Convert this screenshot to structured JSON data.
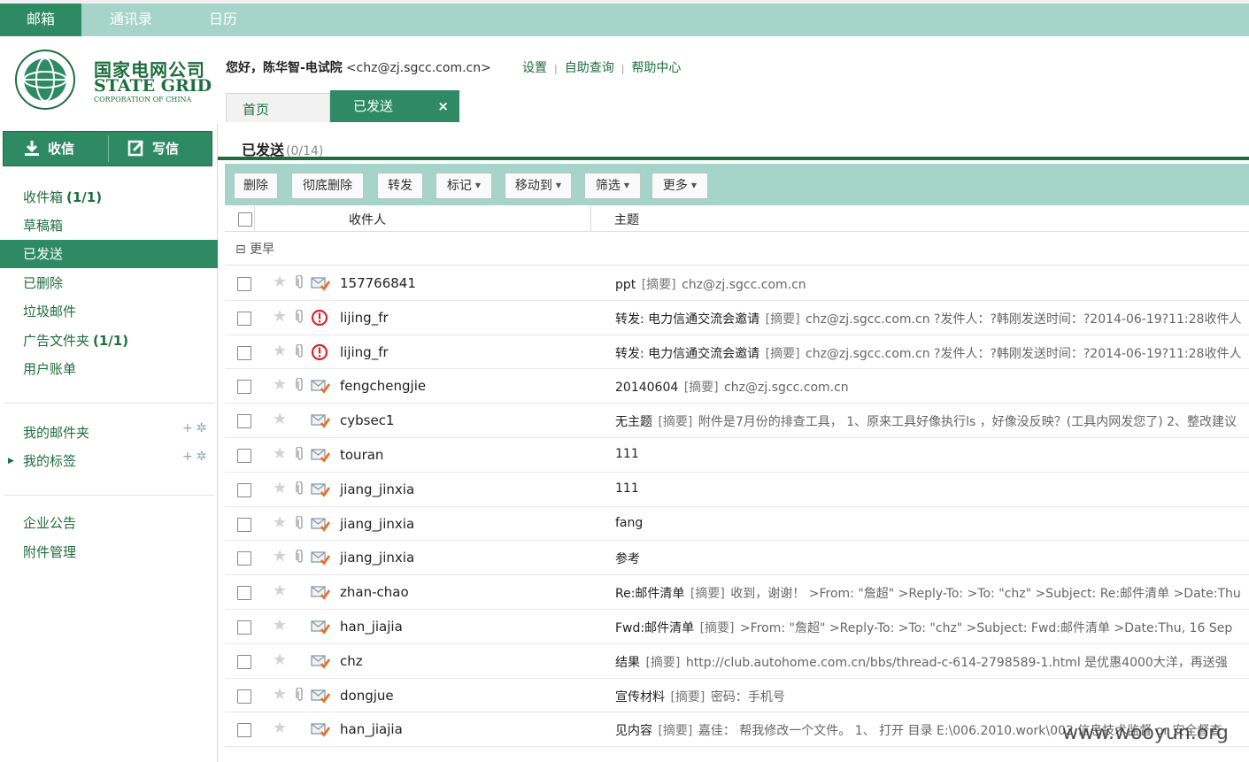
{
  "app_tabs": [
    "邮箱",
    "通讯录",
    "日历"
  ],
  "logo": {
    "cn": "国家电网公司",
    "en": "STATE GRID",
    "sub": "CORPORATION OF CHINA"
  },
  "header": {
    "greeting_prefix": "您好，",
    "user_name": "陈华智-电试院",
    "user_email": "<chz@zj.sgcc.com.cn>",
    "links": [
      "设置",
      "自助查询",
      "帮助中心"
    ]
  },
  "page_tabs": {
    "home": "首页",
    "sent": "已发送",
    "close": "×"
  },
  "sidebar": {
    "receive": "收信",
    "write": "写信",
    "folders": [
      {
        "label": "收件箱",
        "count": "(1/1)"
      },
      {
        "label": "草稿箱",
        "count": ""
      },
      {
        "label": "已发送",
        "count": ""
      },
      {
        "label": "已删除",
        "count": ""
      },
      {
        "label": "垃圾邮件",
        "count": ""
      },
      {
        "label": "广告文件夹",
        "count": "(1/1)"
      },
      {
        "label": "用户账单",
        "count": ""
      }
    ],
    "my_folders": "我的邮件夹",
    "my_tags": "我的标签",
    "notice": "企业公告",
    "attachments": "附件管理"
  },
  "main": {
    "title": "已发送",
    "count": "(0/14)",
    "toolbar": [
      "删除",
      "彻底删除",
      "转发",
      "标记",
      "移动到",
      "筛选",
      "更多"
    ],
    "columns": {
      "recipient": "收件人",
      "subject": "主题"
    },
    "group": "⊟ 更早",
    "summary_tag": "[摘要]",
    "rows": [
      {
        "recipient": "157766841",
        "subject": "ppt",
        "summary": "chz@zj.sgcc.com.cn",
        "attachment": true,
        "icon": "sent-mail-icon"
      },
      {
        "recipient": "lijing_fr",
        "subject": "转发: 电力信通交流会邀请",
        "summary": "chz@zj.sgcc.com.cn ?发件人：?韩刚发送时间：?2014-06-19?11:28收件人",
        "attachment": true,
        "icon": "important-icon"
      },
      {
        "recipient": "lijing_fr",
        "subject": "转发: 电力信通交流会邀请",
        "summary": "chz@zj.sgcc.com.cn ?发件人：?韩刚发送时间：?2014-06-19?11:28收件人",
        "attachment": true,
        "icon": "important-icon"
      },
      {
        "recipient": "fengchengjie",
        "subject": "20140604",
        "summary": "chz@zj.sgcc.com.cn",
        "attachment": true,
        "icon": "sent-mail-icon"
      },
      {
        "recipient": "cybsec1",
        "subject": "无主题",
        "summary": "附件是7月份的排查工具， 1、原来工具好像执行ls ，好像没反映？(工具内网发您了) 2、整改建议",
        "attachment": false,
        "icon": "sent-mail-icon"
      },
      {
        "recipient": "touran",
        "subject": "111",
        "summary": "",
        "attachment": true,
        "icon": "sent-mail-icon"
      },
      {
        "recipient": "jiang_jinxia",
        "subject": "111",
        "summary": "",
        "attachment": true,
        "icon": "sent-mail-icon"
      },
      {
        "recipient": "jiang_jinxia",
        "subject": "fang",
        "summary": "",
        "attachment": true,
        "icon": "sent-mail-icon"
      },
      {
        "recipient": "jiang_jinxia",
        "subject": "参考",
        "summary": "",
        "attachment": true,
        "icon": "sent-mail-icon"
      },
      {
        "recipient": "zhan-chao",
        "subject": "Re:邮件清单",
        "summary": "收到，谢谢！ >From: \"詹超\" >Reply-To: >To: \"chz\" >Subject: Re:邮件清单 >Date:Thu",
        "attachment": false,
        "icon": "sent-mail-icon"
      },
      {
        "recipient": "han_jiajia",
        "subject": "Fwd:邮件清单",
        "summary": ">From: \"詹超\" >Reply-To: >To: \"chz\" >Subject: Fwd:邮件清单 >Date:Thu, 16 Sep",
        "attachment": false,
        "icon": "sent-mail-icon"
      },
      {
        "recipient": "chz",
        "subject": "结果",
        "summary": "http://club.autohome.com.cn/bbs/thread-c-614-2798589-1.html 是优惠4000大洋，再送强",
        "attachment": false,
        "icon": "sent-mail-icon"
      },
      {
        "recipient": "dongjue",
        "subject": "宣传材料",
        "summary": "密码：手机号",
        "attachment": true,
        "icon": "sent-mail-icon"
      },
      {
        "recipient": "han_jiajia",
        "subject": "见内容",
        "summary": "嘉佳： 帮我修改一个文件。 1、 打开 目录 E:\\006.2010.work\\002.信息技术监督 or 安全督查",
        "attachment": false,
        "icon": "sent-mail-icon"
      }
    ]
  },
  "watermark": "www.wooyun.org",
  "colors": {
    "brand": "#1f6d3f",
    "accent": "#2e8a64",
    "toolbar": "#a7d4c8",
    "important": "#d8262e"
  }
}
